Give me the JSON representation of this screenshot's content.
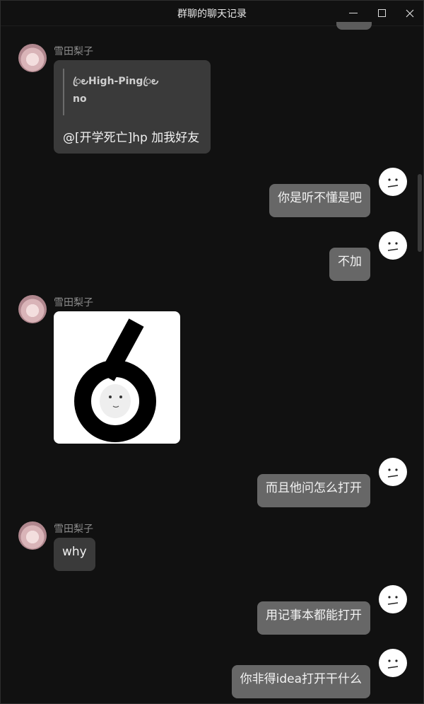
{
  "window": {
    "title": "群聊的聊天记录",
    "controls": [
      "minimize-icon",
      "maximize-icon",
      "close-icon"
    ]
  },
  "messages": [
    {
      "side": "left",
      "sender": "雪田梨子",
      "type": "quote",
      "quote_author": "ꦿ౿High-Pingꦿ౿",
      "quote_text": "no",
      "text": "@[开学死亡]hp 加我好友"
    },
    {
      "side": "right",
      "type": "text",
      "text": "你是听不懂是吧"
    },
    {
      "side": "right",
      "type": "text",
      "text": "不加"
    },
    {
      "side": "left",
      "sender": "雪田梨子",
      "type": "sticker",
      "sticker_icon": "number-six-sticker-icon"
    },
    {
      "side": "right",
      "type": "text",
      "text": "而且他问怎么打开"
    },
    {
      "side": "left",
      "sender": "雪田梨子",
      "type": "text",
      "text": "why"
    },
    {
      "side": "right",
      "type": "text",
      "text": "用记事本都能打开"
    },
    {
      "side": "right",
      "type": "text",
      "text": "你非得idea打开干什么"
    }
  ],
  "colors": {
    "background": "#111111",
    "left_bubble": "#3a3a3a",
    "right_bubble": "#676767",
    "sender_name": "#8c8c8c"
  }
}
